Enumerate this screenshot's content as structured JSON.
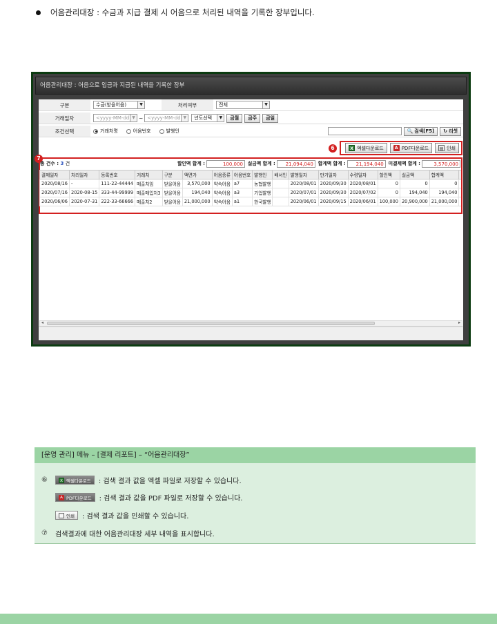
{
  "intro": {
    "text": "어음관리대장 :  수금과 지급 결제 시 어음으로  처리된 내역을 기록한 장부입니다."
  },
  "window": {
    "title": "어음관리대장 : 어음으로 입금과 지급된 내역을 기록한 장부"
  },
  "filter": {
    "type_label": "구분",
    "type_value": "수금(받을어음)",
    "process_label": "처리여부",
    "process_value": "전체",
    "date_label": "거래일자",
    "date_from": "<yyyy-MM-dd>",
    "date_tilde": "~",
    "date_to": "<yyyy-MM-dd>",
    "year_select": "년도선택",
    "period_month": "금월",
    "period_week": "금주",
    "period_day": "금일",
    "cond_label": "조건선택",
    "cond_options": [
      "거래처명",
      "어음번호",
      "발행인"
    ],
    "search_button": "검색[F5]",
    "reset_button": "리셋"
  },
  "toolbar": {
    "excel": "엑셀다운로드",
    "pdf": "PDF다운로드",
    "print": "인쇄"
  },
  "callouts": {
    "c6": "6",
    "c7": "7"
  },
  "summary": {
    "count_label": "총 건수 :",
    "count": "3",
    "count_unit": "건",
    "discount_label": "할인액 합계 :",
    "discount": "100,000",
    "actual_label": "실금액 합계 :",
    "actual": "21,094,040",
    "total_label": "합계액 합계 :",
    "total": "21,194,040",
    "unsettled_label": "미결제액 합계 :",
    "unsettled": "3,570,000"
  },
  "grid": {
    "headers": [
      "결제일자",
      "처리일자",
      "등록번호",
      "거래처",
      "구분",
      "액면가",
      "어음종류",
      "어음번호",
      "발행인",
      "배서인",
      "발행일자",
      "만기일자",
      "수령일자",
      "할인액",
      "실금액",
      "합계액",
      "미"
    ],
    "rows": [
      [
        "2020/08/16",
        "-",
        "111-22-44444",
        "매출처임",
        "받을어음",
        "3,570,000",
        "약속어음",
        "a7",
        "농협발행",
        "",
        "2020/08/01",
        "2020/09/30",
        "2020/08/01",
        "0",
        "0",
        "0",
        "3,5"
      ],
      [
        "2020/07/16",
        "2020-08-15",
        "333-44-99999",
        "매출매입처3",
        "받을어음",
        "194,040",
        "약속어음",
        "a3",
        "기업발행",
        "",
        "2020/07/01",
        "2020/09/30",
        "2020/07/02",
        "0",
        "194,040",
        "194,040",
        ""
      ],
      [
        "2020/06/06",
        "2020-07-31",
        "222-33-66666",
        "매출처2",
        "받을어음",
        "21,000,000",
        "약속어음",
        "a1",
        "한국발행",
        "",
        "2020/06/01",
        "2020/09/15",
        "2020/06/01",
        "100,000",
        "20,900,000",
        "21,000,000",
        ""
      ]
    ]
  },
  "info": {
    "header": "[운영 관리] 메뉴 – [결제 리포트]  – “어음관리대장”",
    "mark6": "⑥",
    "mark7": "⑦",
    "excel_btn": "엑셀다운로드",
    "excel_desc": ": 검색 결과 값을 엑셀 파일로 저장할 수 있습니다.",
    "pdf_btn": "PDF다운로드",
    "pdf_desc": ": 검색 결과 값을 PDF 파일로 저장할 수 있습니다.",
    "print_btn": "인쇄",
    "print_desc": ": 검색 결과 값을 인쇄할 수 있습니다.",
    "grid_desc": "검색결과에 대한 어음관리대장 세부 내역을 표시합니다."
  },
  "colors": {
    "accent_red": "#d32020",
    "frame_green": "#0b3b10",
    "info_green": "#9bd4a4"
  }
}
